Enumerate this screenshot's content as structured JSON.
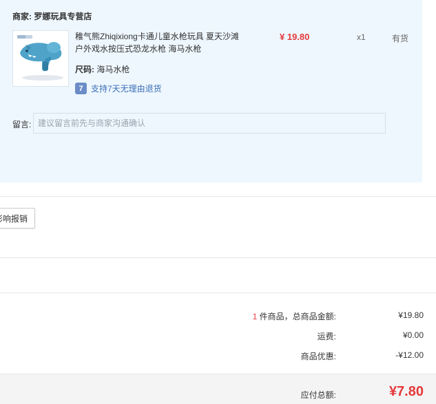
{
  "store": {
    "label": "商家:",
    "name": "罗娜玩具专营店"
  },
  "product": {
    "title": "稚气熊Zhiqixiong卡通儿童水枪玩具 夏天沙滩户外戏水按压式恐龙水枪 海马水枪",
    "price": "¥ 19.80",
    "quantity": "x1",
    "stock": "有货",
    "spec_label": "尺码:",
    "spec_value": "海马水枪",
    "return_icon_glyph": "7",
    "return_policy": "支持7天无理由退货",
    "thumb_icon": "water-gun-image"
  },
  "remark": {
    "label": "留言:",
    "placeholder": "建议留言前先与商家沟通确认"
  },
  "reimburse_button": "影响报销",
  "summary": {
    "items_count": "1",
    "items_label": " 件商品，总商品金额:",
    "items_total": "¥19.80",
    "shipping_label": "运费:",
    "shipping_value": "¥0.00",
    "discount_label": "商品优惠:",
    "discount_value": "-¥12.00",
    "payable_label": "应付总额:",
    "payable_value": "¥7.80"
  },
  "colors": {
    "accent_red": "#e4393c",
    "panel_bg": "#eef7fe",
    "link_blue": "#3b6fb6"
  }
}
